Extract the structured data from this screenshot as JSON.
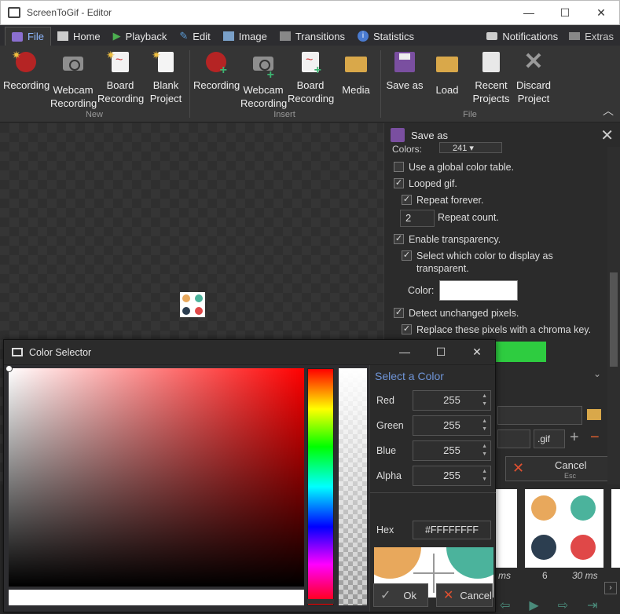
{
  "window": {
    "title": "ScreenToGif - Editor",
    "minimize": "—",
    "maximize": "☐",
    "close": "✕"
  },
  "tabs": [
    {
      "label": "File",
      "active": true
    },
    {
      "label": "Home"
    },
    {
      "label": "Playback"
    },
    {
      "label": "Edit"
    },
    {
      "label": "Image"
    },
    {
      "label": "Transitions"
    },
    {
      "label": "Statistics"
    }
  ],
  "tabbar_right": {
    "notifications": "Notifications",
    "extras": "Extras"
  },
  "ribbon": {
    "new": {
      "label": "New",
      "recording": "Recording",
      "webcam_1": "Webcam",
      "webcam_2": "Recording",
      "board_1": "Board",
      "board_2": "Recording",
      "blank_1": "Blank",
      "blank_2": "Project"
    },
    "insert": {
      "label": "Insert",
      "recording": "Recording",
      "webcam_1": "Webcam",
      "webcam_2": "Recording",
      "board_1": "Board",
      "board_2": "Recording",
      "media": "Media"
    },
    "file": {
      "label": "File",
      "save_as": "Save as",
      "load": "Load",
      "recent_1": "Recent",
      "recent_2": "Projects",
      "discard_1": "Discard",
      "discard_2": "Project"
    }
  },
  "save_panel": {
    "title": "Save as",
    "colors_label": "Colors:",
    "colors_value": "241",
    "global_color_table": "Use a global color table.",
    "looped_gif": "Looped gif.",
    "repeat_forever": "Repeat forever.",
    "repeat_count_value": "2",
    "repeat_count": "Repeat count.",
    "enable_transparency": "Enable transparency.",
    "select_transparent_1": "Select which color to display as",
    "select_transparent_2": "transparent.",
    "color_label": "Color:",
    "detect_unchanged": "Detect unchanged pixels.",
    "replace_chroma": "Replace these pixels with a chroma key.",
    "extension": ".gif",
    "cancel": "Cancel",
    "cancel_hint": "Esc",
    "chroma_color": "#2ecc40",
    "transparent_color": "#ffffff"
  },
  "filmstrip": {
    "frame_number": "6",
    "frame_delay": "30 ms",
    "frame_delay_prev": "ms"
  },
  "color_selector": {
    "title": "Color Selector",
    "heading": "Select a Color",
    "red_label": "Red",
    "red": "255",
    "green_label": "Green",
    "green": "255",
    "blue_label": "Blue",
    "blue": "255",
    "alpha_label": "Alpha",
    "alpha": "255",
    "hex_label": "Hex",
    "hex": "#FFFFFFFF",
    "ok": "Ok",
    "cancel": "Cancel"
  },
  "colors": {
    "accent": "#6f95d8",
    "dot_orange": "#e8a85c",
    "dot_teal": "#4bb39c",
    "dot_navy": "#2c3e50",
    "dot_red": "#e04848"
  }
}
